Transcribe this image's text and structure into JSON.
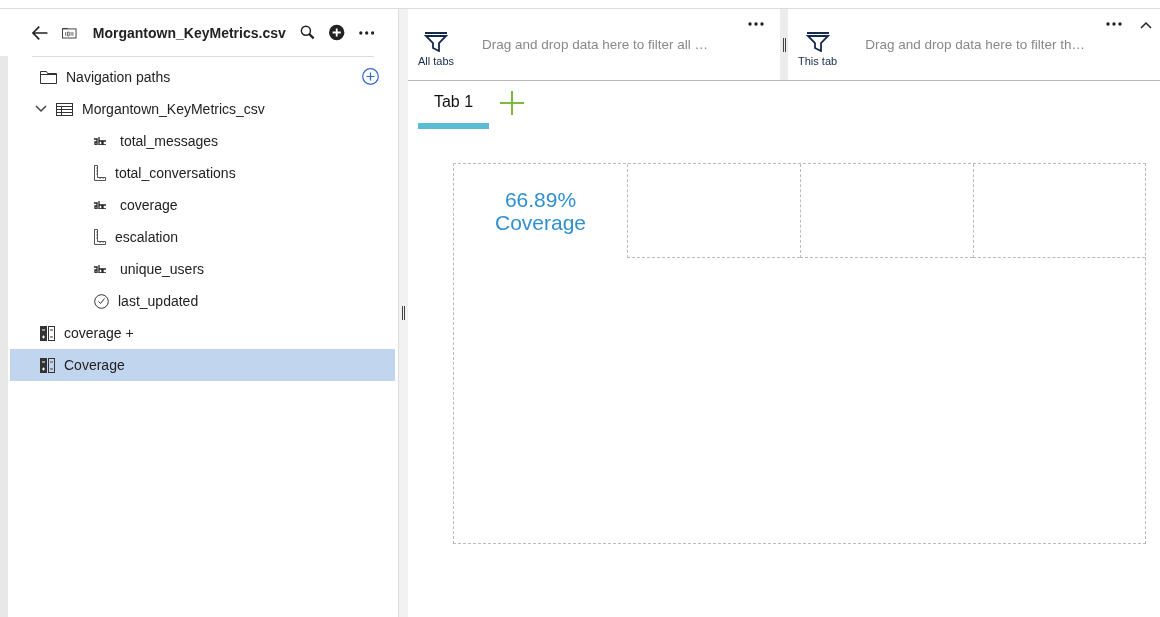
{
  "source_panel": {
    "title": "Morgantown_KeyMetrics.csv",
    "tree": [
      {
        "label": "Navigation paths",
        "kind": "folder",
        "selected": false,
        "action": true
      },
      {
        "label": "Morgantown_KeyMetrics_csv",
        "kind": "table",
        "selected": false,
        "expanded": true,
        "children": [
          {
            "label": "total_messages",
            "kind": "text",
            "selected": false
          },
          {
            "label": "total_conversations",
            "kind": "measure",
            "selected": false
          },
          {
            "label": "coverage",
            "kind": "text",
            "selected": false
          },
          {
            "label": "escalation",
            "kind": "measure",
            "selected": false
          },
          {
            "label": "unique_users",
            "kind": "text",
            "selected": false
          },
          {
            "label": "last_updated",
            "kind": "time",
            "selected": false
          }
        ]
      },
      {
        "label": "coverage +",
        "kind": "calc",
        "selected": false
      },
      {
        "label": "Coverage",
        "kind": "calc",
        "selected": true
      }
    ]
  },
  "filters": [
    {
      "label": "All tabs",
      "placeholder": "Drag and drop data here to filter all …"
    },
    {
      "label": "This tab",
      "placeholder": "Drag and drop data here to filter th…"
    }
  ],
  "tabs": [
    {
      "label": "Tab 1",
      "selected": true
    }
  ],
  "widget": {
    "value": "66.89%",
    "label": "Coverage"
  }
}
